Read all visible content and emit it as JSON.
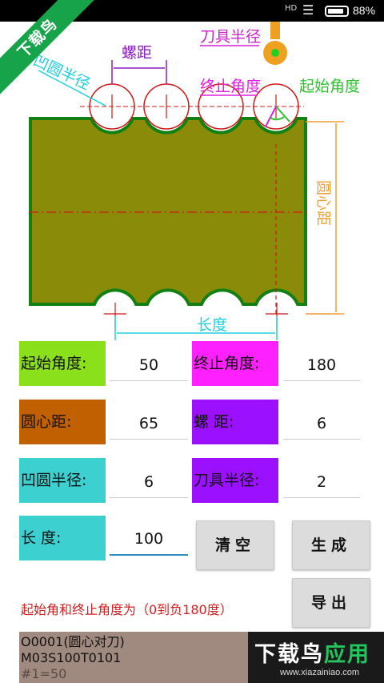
{
  "status_bar": {
    "signal_label": "HD",
    "battery_percent": "88%",
    "battery_level": 0.88,
    "icons": [
      "signal-icon",
      "wifi-icon",
      "battery-icon"
    ]
  },
  "watermark": {
    "ribbon_text": "下载鸟"
  },
  "diagram": {
    "labels": {
      "pitch": "螺距",
      "tool_radius": "刀具半径",
      "concave_radius": "凹圆半径",
      "end_angle": "终止角度",
      "start_angle": "起始角度",
      "center_distance": "圆心距",
      "length": "长度"
    },
    "colors": {
      "body": "#8b8b0a",
      "border": "#138013",
      "centerline": "#d01818",
      "pitch_label": "#8b1fc0",
      "tool_label": "#d020d0",
      "concave_label": "#20d0e0",
      "end_angle_label": "#e020e0",
      "start_angle_label": "#30c030",
      "center_distance_label": "#f0a030",
      "length_label": "#20d0e0",
      "tool_fill": "#f0a020",
      "tool_dot": "#20d020"
    }
  },
  "params": {
    "start_angle": {
      "label": "起始角度:",
      "value": "50",
      "color": "#8be01c"
    },
    "end_angle": {
      "label": "终止角度:",
      "value": "180",
      "color": "#ff20ff"
    },
    "center_distance": {
      "label": "圆心距:",
      "value": "65",
      "color": "#c06000"
    },
    "pitch": {
      "label": "螺  距:",
      "value": "6",
      "color": "#9b10ff"
    },
    "concave_radius": {
      "label": "凹圆半径:",
      "value": "6",
      "color": "#3cd0d0"
    },
    "tool_radius": {
      "label": "刀具半径:",
      "value": "2",
      "color": "#9b10ff"
    },
    "length": {
      "label": "长  度:",
      "value": "100",
      "color": "#3cd0d0"
    }
  },
  "buttons": {
    "clear": "清空",
    "generate": "生成",
    "export": "导出"
  },
  "note": "起始角和终止角度为（0到负180度）",
  "output_lines": [
    "O0001(圆心对刀)",
    "M03S100T0101",
    "#1=50"
  ],
  "brand": {
    "title_white": "下载鸟",
    "title_green": "应用",
    "url": "www.xiazainiao.com"
  }
}
